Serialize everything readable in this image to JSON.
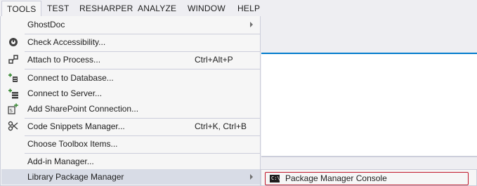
{
  "menubar": {
    "items": [
      "TOOLS",
      "TEST",
      "RESHARPER",
      "ANALYZE",
      "WINDOW",
      "HELP"
    ]
  },
  "tools_menu": {
    "items": [
      {
        "label": "GhostDoc",
        "icon": "none",
        "submenu": true
      },
      {
        "label": "Check Accessibility...",
        "icon": "accessibility-icon"
      },
      {
        "label": "Attach to Process...",
        "shortcut": "Ctrl+Alt+P",
        "icon": "attach-process-icon"
      },
      {
        "label": "Connect to Database...",
        "icon": "connect-database-icon"
      },
      {
        "label": "Connect to Server...",
        "icon": "connect-server-icon"
      },
      {
        "label": "Add SharePoint Connection...",
        "icon": "sharepoint-icon"
      },
      {
        "label": "Code Snippets Manager...",
        "shortcut": "Ctrl+K, Ctrl+B",
        "icon": "snippets-icon"
      },
      {
        "label": "Choose Toolbox Items...",
        "icon": "none"
      },
      {
        "label": "Add-in Manager...",
        "icon": "none"
      },
      {
        "label": "Library Package Manager",
        "icon": "none",
        "submenu": true
      }
    ]
  },
  "submenu": {
    "items": [
      {
        "label": "Package Manager Console",
        "icon": "console-icon",
        "icon_text": "C:\\"
      }
    ]
  },
  "colors": {
    "menu_bg": "#f6f6f6",
    "highlight": "#d8dce6",
    "accent": "#007acc",
    "selection_outline": "#c0162a"
  }
}
